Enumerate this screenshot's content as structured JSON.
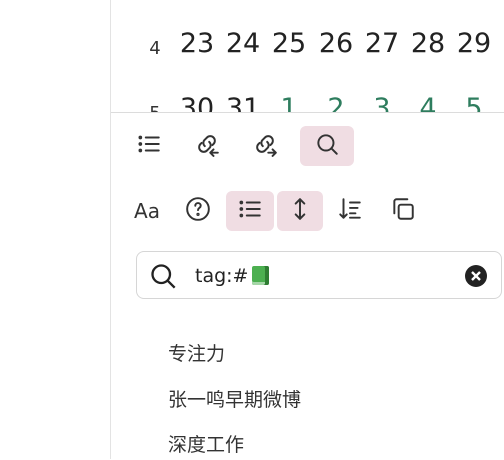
{
  "calendar": {
    "rows": [
      {
        "week": "4",
        "days": [
          "23",
          "24",
          "25",
          "26",
          "27",
          "28",
          "29"
        ],
        "next_month_from": 7
      },
      {
        "week": "5",
        "days": [
          "30",
          "31",
          "1",
          "2",
          "3",
          "4",
          "5"
        ],
        "next_month_from": 2
      }
    ]
  },
  "toolbar": {
    "row1": [
      {
        "icon": "list-icon",
        "active": false
      },
      {
        "icon": "backlink-icon",
        "active": false
      },
      {
        "icon": "outgoing-link-icon",
        "active": false
      },
      {
        "icon": "search-icon",
        "active": true
      }
    ],
    "row2": [
      {
        "icon": "font-size-icon",
        "label": "Aa",
        "active": false
      },
      {
        "icon": "help-icon",
        "active": false
      },
      {
        "icon": "list-icon",
        "active": true
      },
      {
        "icon": "expand-vertical-icon",
        "active": true
      },
      {
        "icon": "sort-icon",
        "active": false
      },
      {
        "icon": "copy-icon",
        "active": false
      }
    ]
  },
  "search": {
    "value": "tag:#",
    "emoji": "green-book",
    "clear_icon": "close-circle-icon"
  },
  "results": [
    "专注力",
    "张一鸣早期微博",
    "深度工作"
  ],
  "colors": {
    "active_bg": "#f0dde3",
    "next_month_text": "#2e7d5e"
  }
}
